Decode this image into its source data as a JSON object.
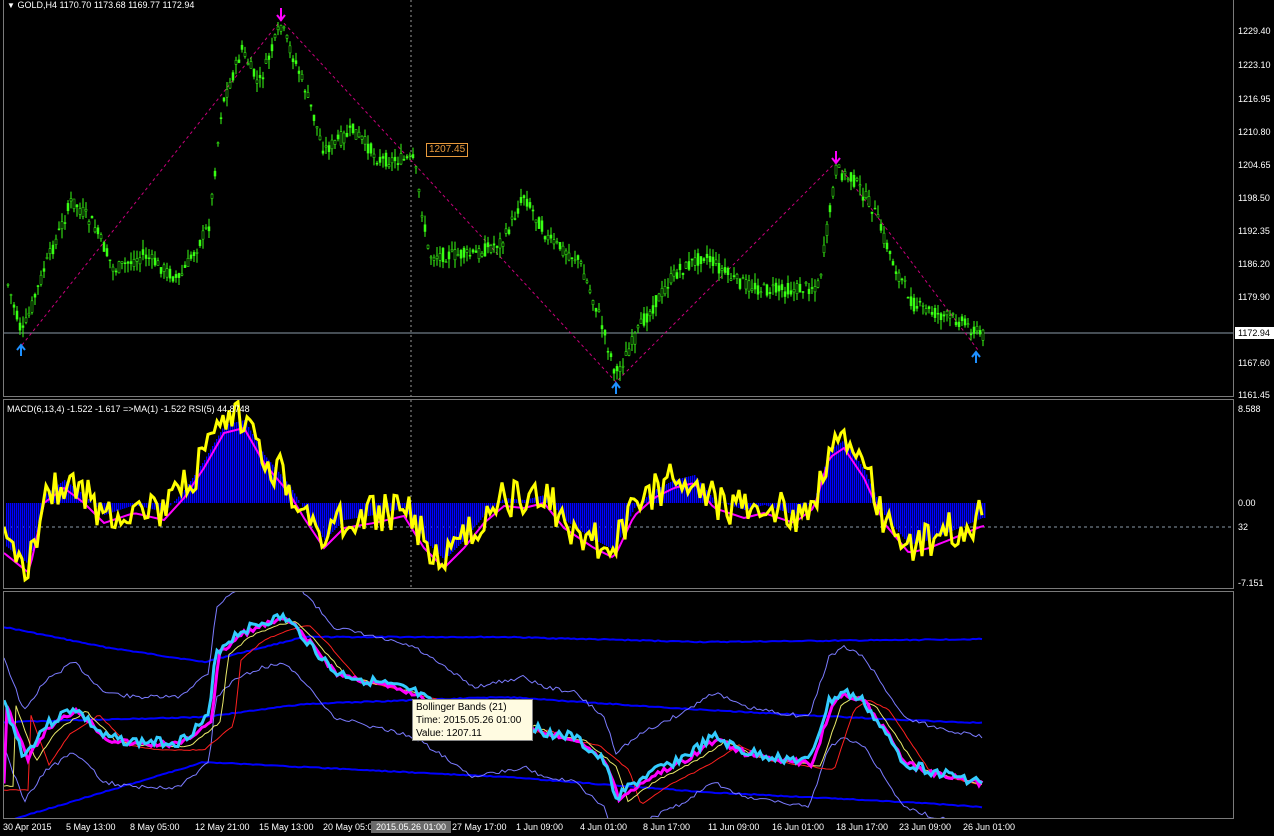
{
  "main_pane": {
    "title": "GOLD,H4  1170.70 1173.68 1169.77 1172.94",
    "symbol_dropdown_icon": "triangle-down-icon",
    "y_ticks": [
      "1229.40",
      "1223.10",
      "1216.95",
      "1210.80",
      "1204.65",
      "1198.50",
      "1192.35",
      "1186.20",
      "1179.90",
      "1172.94",
      "1167.60",
      "1161.45"
    ],
    "current_price": "1172.94",
    "level_label": "1207.45",
    "zigzag_color": "#c8007c",
    "candle_color": "#39ff14",
    "up_arrow_color": "#1e90ff",
    "down_arrow_color": "#ff00ff"
  },
  "macd_pane": {
    "title": "MACD(6,13,4) -1.522 -1.617  =>MA(1) -1.522  RSI(5) 44.8748",
    "y_ticks": [
      "8.588",
      "0.00",
      "32",
      "-7.151"
    ],
    "histogram_color": "#0000ff",
    "macd_line_color": "#ffff00",
    "signal_line_color": "#ff00ff"
  },
  "bb_pane": {
    "tooltip": {
      "line1": "Bollinger Bands (21)",
      "line2": "Time: 2015.05.26 01:00",
      "line3": "Value: 1207.11"
    }
  },
  "x_axis": {
    "labels": [
      "30 Apr 2015",
      "5 May 13:00",
      "8 May 05:00",
      "12 May 21:00",
      "15 May 13:00",
      "20 May 05:00",
      "27 May 17:00",
      "1 Jun 09:00",
      "4 Jun 01:00",
      "8 Jun 17:00",
      "11 Jun 09:00",
      "16 Jun 01:00",
      "18 Jun 17:00",
      "23 Jun 09:00",
      "26 Jun 01:00"
    ],
    "highlighted_label": "2015.05.26 01:00"
  }
}
